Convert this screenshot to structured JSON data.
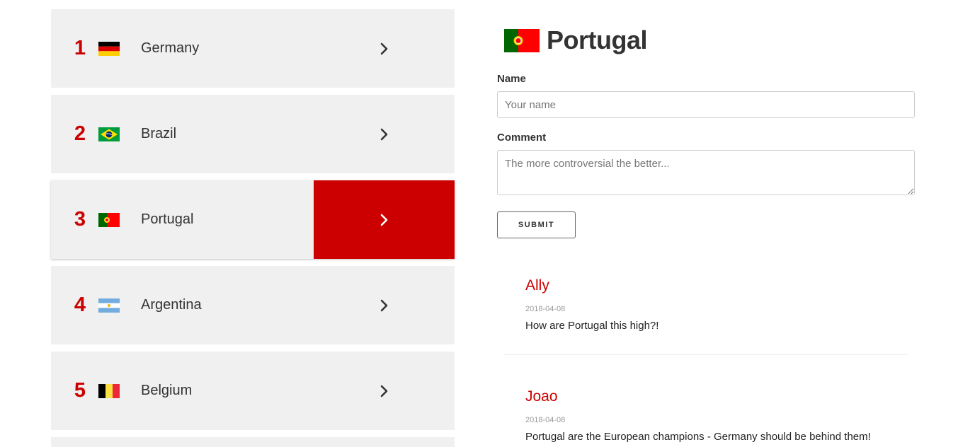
{
  "ranking": [
    {
      "rank": "1",
      "country": "Germany",
      "flag": "germany-flag"
    },
    {
      "rank": "2",
      "country": "Brazil",
      "flag": "brazil-flag"
    },
    {
      "rank": "3",
      "country": "Portugal",
      "flag": "portugal-flag",
      "selected": true
    },
    {
      "rank": "4",
      "country": "Argentina",
      "flag": "argentina-flag"
    },
    {
      "rank": "5",
      "country": "Belgium",
      "flag": "belgium-flag"
    }
  ],
  "detail": {
    "country": "Portugal",
    "flag": "portugal-flag",
    "form": {
      "name_label": "Name",
      "name_placeholder": "Your name",
      "comment_label": "Comment",
      "comment_placeholder": "The more controversial the better...",
      "submit_label": "SUBMIT"
    },
    "comments": [
      {
        "author": "Ally",
        "date": "2018-04-08",
        "text": "How are Portugal this high?!"
      },
      {
        "author": "Joao",
        "date": "2018-04-08",
        "text": "Portugal are the European champions - Germany should be behind them!"
      }
    ]
  },
  "colors": {
    "accent": "#cc0000",
    "row_bg": "#f0f0f0",
    "text": "#333333"
  },
  "icons": {
    "chevron": "chevron-right-icon"
  }
}
